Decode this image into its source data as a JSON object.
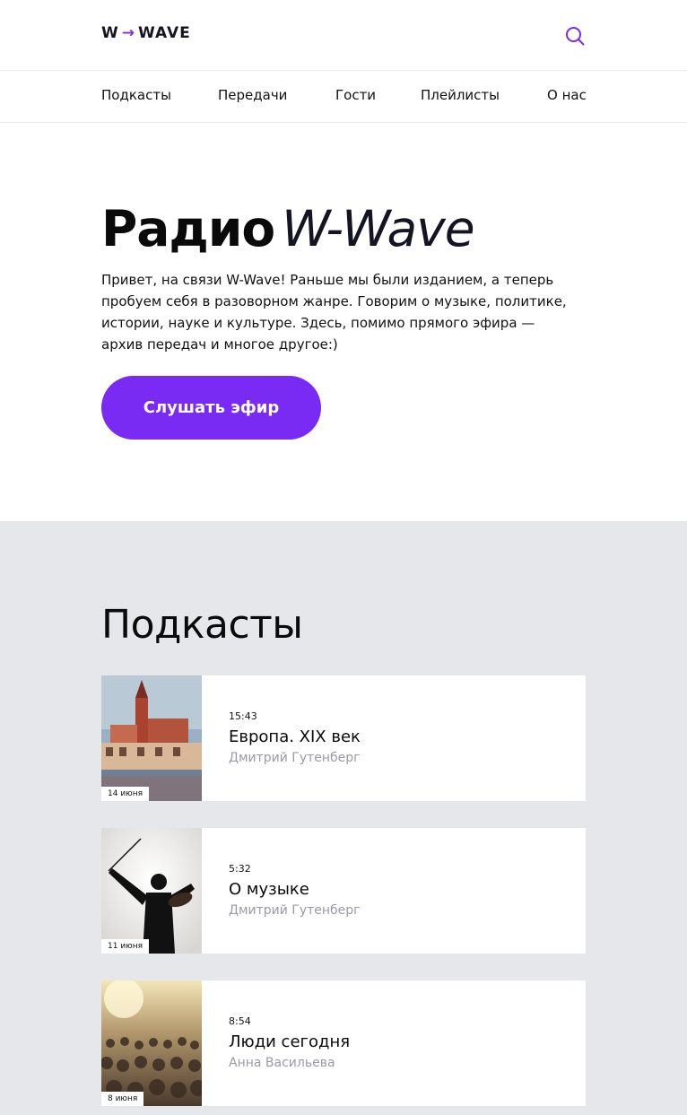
{
  "header": {
    "logo_left": "W",
    "logo_arrow": "→",
    "logo_right": "WAVE",
    "accent_color": "#7a2bf3",
    "search_icon": "search-icon"
  },
  "nav": {
    "items": [
      "Подкасты",
      "Передачи",
      "Гости",
      "Плейлисты",
      "О нас"
    ]
  },
  "hero": {
    "title_main": "Радио",
    "title_em": "W-Wave",
    "lead": "Привет, на связи W-Wave! Раньше мы были изданием, а теперь пробуем себя в разоворном жанре. Говорим о музыке, политике, истории, науке и культуре. Здесь, помимо прямого эфира — архив передач и многое другое:)",
    "button_label": "Слушать эфир"
  },
  "podcasts": {
    "heading": "Подкасты",
    "items": [
      {
        "date": "14 июня",
        "time": "15:43",
        "title": "Европа. XIX век",
        "author": "Дмитрий Гутенберг"
      },
      {
        "date": "11 июня",
        "time": "5:32",
        "title": "О музыке",
        "author": "Дмитрий Гутенберг"
      },
      {
        "date": "8 июня",
        "time": "8:54",
        "title": "Люди сегодня",
        "author": "Анна Васильева"
      }
    ]
  }
}
